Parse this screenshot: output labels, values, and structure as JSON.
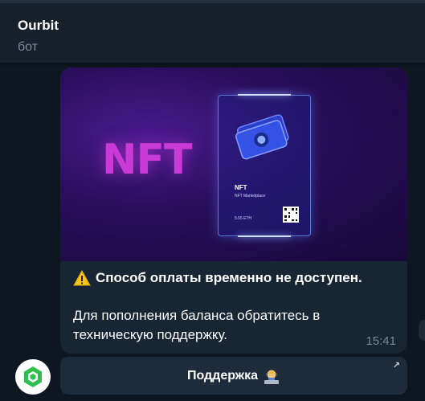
{
  "header": {
    "title": "Ourbit",
    "subtitle": "бот"
  },
  "message": {
    "banner": {
      "logo_text": "NFT",
      "card_title": "NFT",
      "card_subtitle": "NFT Marketplace",
      "card_price": "5.55 ETH"
    },
    "warning_icon": "warning-icon",
    "headline": "Способ оплаты временно не доступен.",
    "body": "Для пополнения баланса обратитесь в техническую поддержку.",
    "time": "15:41"
  },
  "keyboard": {
    "button_label": "Поддержка",
    "button_icon": "support-agent-icon",
    "link_icon": "external-arrow-icon"
  },
  "avatar": {
    "icon": "ourbit-logo",
    "color": "#2fbf4f"
  }
}
